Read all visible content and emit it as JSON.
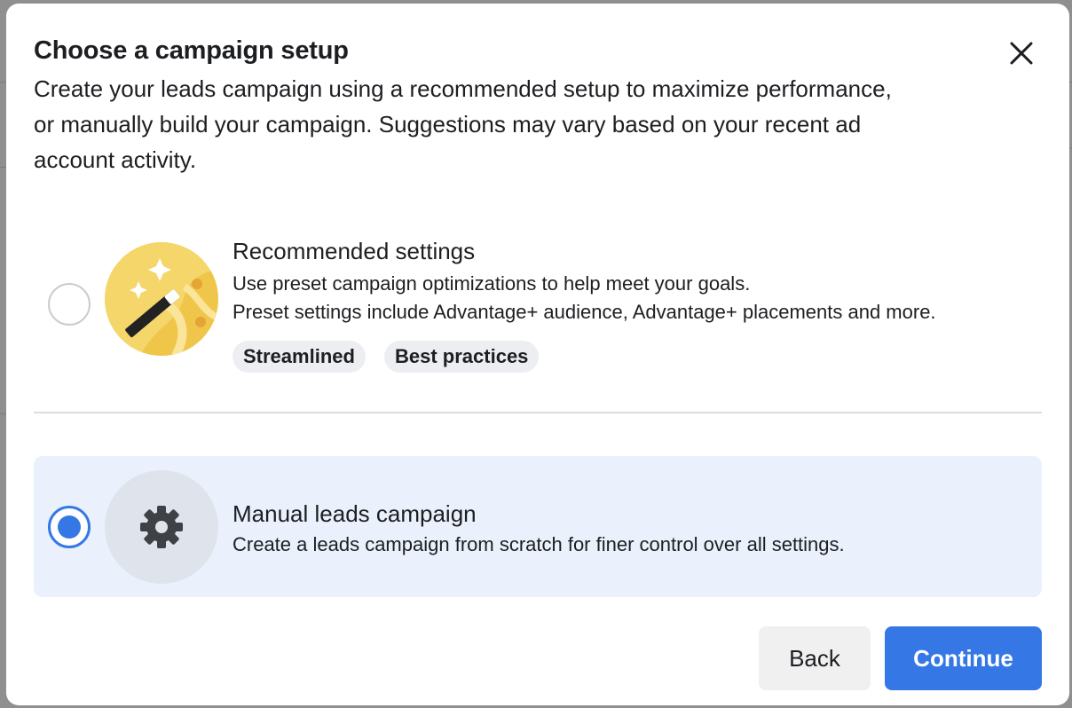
{
  "dialog": {
    "title": "Choose a campaign setup",
    "subtitle_lines": [
      "Create your leads campaign using a recommended setup to maximize performance,",
      "or manually build your campaign. Suggestions may vary based on your recent ad",
      "account activity."
    ],
    "close_icon": "close-icon"
  },
  "options": {
    "recommended": {
      "title": "Recommended settings",
      "desc_lines": [
        "Use preset campaign optimizations to help meet your goals.",
        "Preset settings include Advantage+ audience, Advantage+ placements and more."
      ],
      "chips": [
        "Streamlined",
        "Best practices"
      ],
      "selected": false,
      "icon": "magic-wand-icon"
    },
    "manual": {
      "title": "Manual leads campaign",
      "desc": "Create a leads campaign from scratch for finer control over all settings.",
      "selected": true,
      "icon": "gear-icon"
    }
  },
  "footer": {
    "back_label": "Back",
    "continue_label": "Continue"
  },
  "colors": {
    "accent": "#3578e5",
    "selected_bg": "#eaf1fc",
    "illustration_yellow": "#f5d66b"
  }
}
